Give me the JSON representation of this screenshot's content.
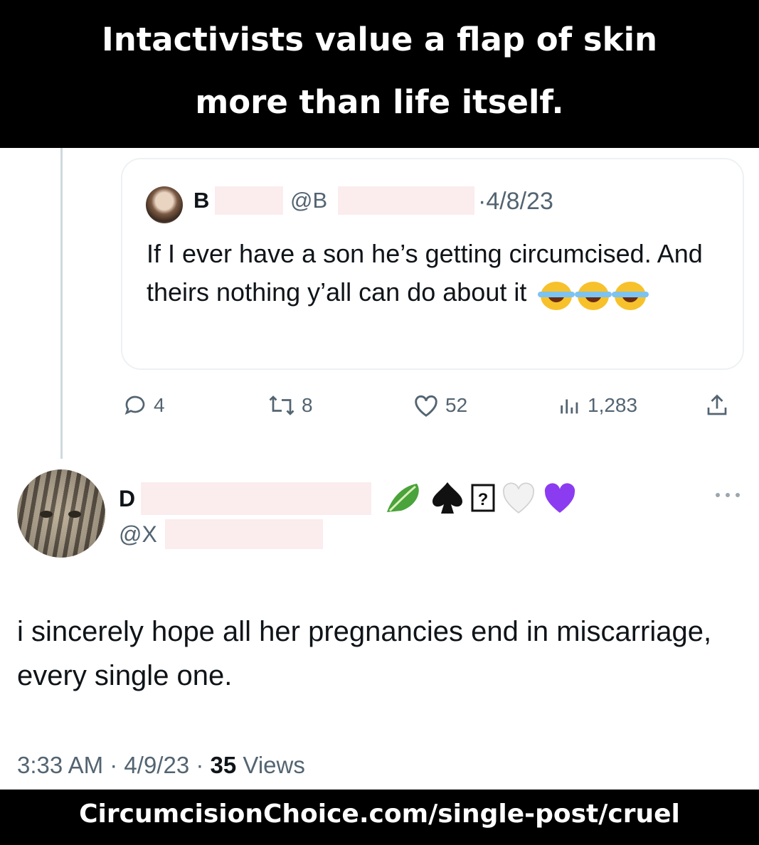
{
  "banner": {
    "line1": "Intactivists value a flap of skin",
    "line2": "more than life itself."
  },
  "quoted_tweet": {
    "name": "B",
    "handle": "@B",
    "date": "·4/8/23",
    "text": "If I ever have a son he’s getting circumcised. And theirs nothing y’all can do about it",
    "emoji_icons": [
      "laughing-tears-icon",
      "laughing-tears-icon",
      "laughing-tears-icon"
    ]
  },
  "actions": {
    "replies": "4",
    "retweets": "8",
    "likes": "52",
    "views": "1,283"
  },
  "reply_tweet": {
    "name": "D",
    "handle": "@X",
    "name_emojis": [
      "lettuce-icon",
      "spade-icon",
      "unknown-glyph-icon",
      "white-heart-icon",
      "purple-heart-icon"
    ],
    "text": "i sincerely hope all her pregnancies end in miscarriage, every single one.",
    "time": "3:33 AM",
    "date": "4/9/23",
    "views_count": "35",
    "views_label": "Views"
  },
  "footer": {
    "url": "CircumcisionChoice.com/single-post/cruel"
  },
  "colors": {
    "banner_bg": "#000000",
    "banner_text": "#ffffff",
    "muted_text": "#536471",
    "heart_purple": "#8b3cf0",
    "redaction": "#fbecee"
  }
}
